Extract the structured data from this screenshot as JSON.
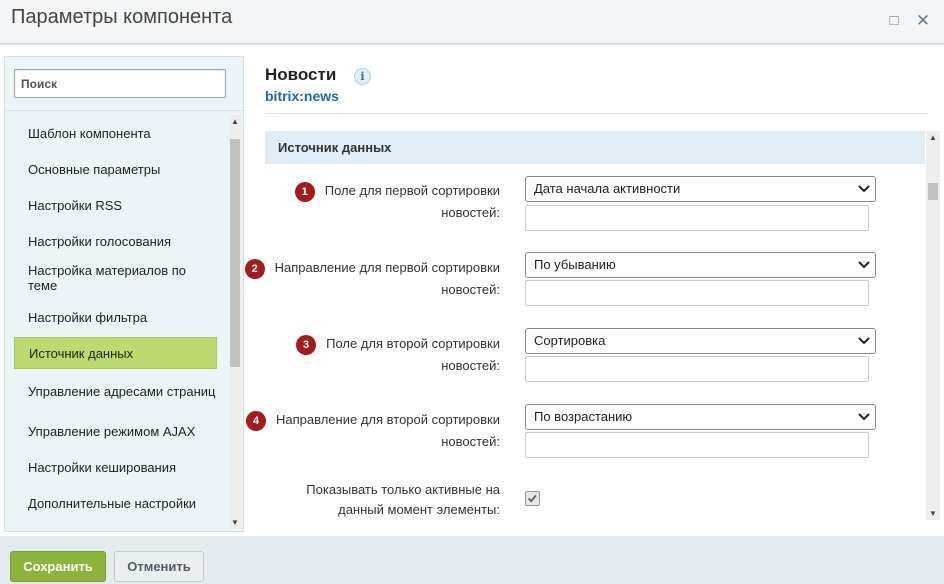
{
  "window": {
    "title": "Параметры компонента",
    "maximize_icon": "□",
    "close_icon": "✕"
  },
  "sidebar": {
    "search_placeholder": "Поиск",
    "items": [
      {
        "label": "Шаблон компонента"
      },
      {
        "label": "Основные параметры"
      },
      {
        "label": "Настройки RSS"
      },
      {
        "label": "Настройки голосования"
      },
      {
        "label": "Настройка материалов по теме"
      },
      {
        "label": "Настройки фильтра"
      },
      {
        "label": "Источник данных",
        "active": true
      },
      {
        "label": "Управление адресами страниц"
      },
      {
        "label": "Управление режимом AJAX"
      },
      {
        "label": "Настройки кеширования"
      },
      {
        "label": "Дополнительные настройки"
      }
    ]
  },
  "panel": {
    "title": "Новости",
    "info_icon": "i",
    "subtitle": "bitrix:news"
  },
  "section": {
    "title": "Источник данных",
    "params": [
      {
        "badge": "1",
        "label": "Поле для первой сортировки",
        "label2": "новостей:",
        "value": "Дата начала активности"
      },
      {
        "badge": "2",
        "label": "Направление для первой сортировки",
        "label2": "новостей:",
        "value": "По убыванию"
      },
      {
        "badge": "3",
        "label": "Поле для второй сортировки",
        "label2": "новостей:",
        "value": "Сортировка"
      },
      {
        "badge": "4",
        "label": "Направление для второй сортировки",
        "label2": "новостей:",
        "value": "По возрастанию"
      }
    ],
    "checkbox": {
      "label": "Показывать только активные на",
      "label2": "данный момент элементы:",
      "checked": true
    }
  },
  "footer": {
    "save_label": "Сохранить",
    "cancel_label": "Отменить"
  },
  "colors": {
    "active_item": "#bcda6e",
    "save_button": "#8cb43d",
    "badge": "#a31b1b",
    "subtitle_link": "#2067b0",
    "section_header": "#e1ecf4"
  }
}
